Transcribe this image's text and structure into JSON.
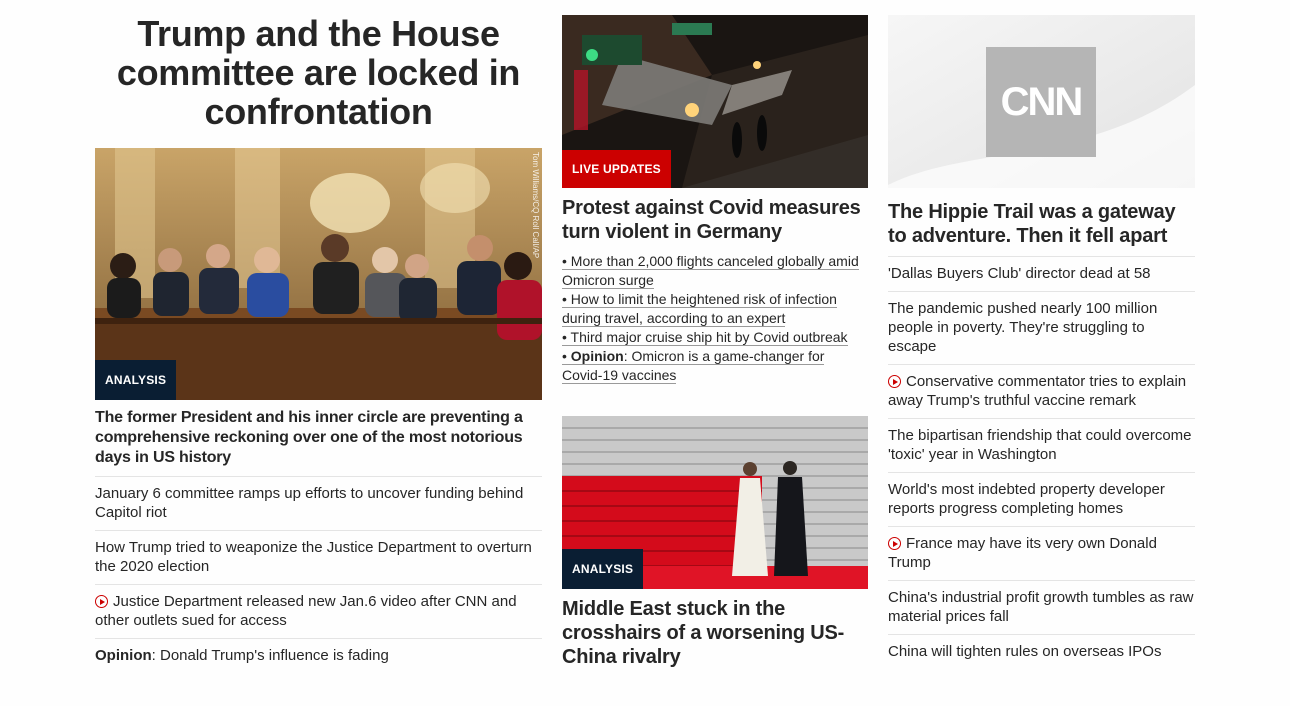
{
  "column1": {
    "hero_title": "Trump and the House committee are locked in confrontation",
    "photo_badge": "ANALYSIS",
    "photo_credit": "Tom Williams/CQ Roll Call/AP",
    "headline": "The former President and his inner circle are preventing a comprehensive reckoning over one of the most notorious days in US history",
    "items": [
      {
        "text": "January 6 committee ramps up efforts to uncover funding behind Capitol riot"
      },
      {
        "text": "How Trump tried to weaponize the Justice Department to overturn the 2020 election"
      },
      {
        "icon": "play-video-icon",
        "text": "Justice Department released new Jan.6 video after CNN and other outlets sued for access"
      },
      {
        "label": "Opinion",
        "text": ": Donald Trump's influence is fading"
      }
    ]
  },
  "column2": {
    "story1": {
      "photo_badge": "LIVE UPDATES",
      "headline": "Protest against Covid measures turn violent in Germany",
      "bullets": [
        {
          "text": "• More than 2,000 flights canceled globally amid Omicron surge"
        },
        {
          "text": "• How to limit the heightened risk of infection during travel, according to an expert"
        },
        {
          "text": "• Third major cruise ship hit by Covid outbreak"
        },
        {
          "prefix": "• ",
          "label": "Opinion",
          "text": ": Omicron is a game-changer for Covid-19 vaccines"
        }
      ]
    },
    "story2": {
      "photo_badge": "ANALYSIS",
      "headline": "Middle East stuck in the crosshairs of a worsening US-China rivalry"
    }
  },
  "column3": {
    "logo_text": "CNN",
    "headline": "The Hippie Trail was a gateway to adventure. Then it fell apart",
    "items": [
      {
        "text": "'Dallas Buyers Club' director dead at 58"
      },
      {
        "text": "The pandemic pushed nearly 100 million people in poverty. They're struggling to escape"
      },
      {
        "icon": "play-video-icon",
        "text": "Conservative commentator tries to explain away Trump's truthful vaccine remark"
      },
      {
        "text": "The bipartisan friendship that could overcome 'toxic' year in Washington"
      },
      {
        "text": "World's most indebted property developer reports progress completing homes"
      },
      {
        "icon": "play-video-icon",
        "text": "France may have its very own Donald Trump"
      },
      {
        "text": "China's industrial profit growth tumbles as raw material prices fall"
      },
      {
        "text": "China will tighten rules on overseas IPOs"
      }
    ]
  },
  "colors": {
    "badge_dark": "#0a1e33",
    "badge_red": "#cc0000",
    "text": "#262626",
    "divider": "#e4e4e4",
    "play_icon": "#cc0000"
  }
}
